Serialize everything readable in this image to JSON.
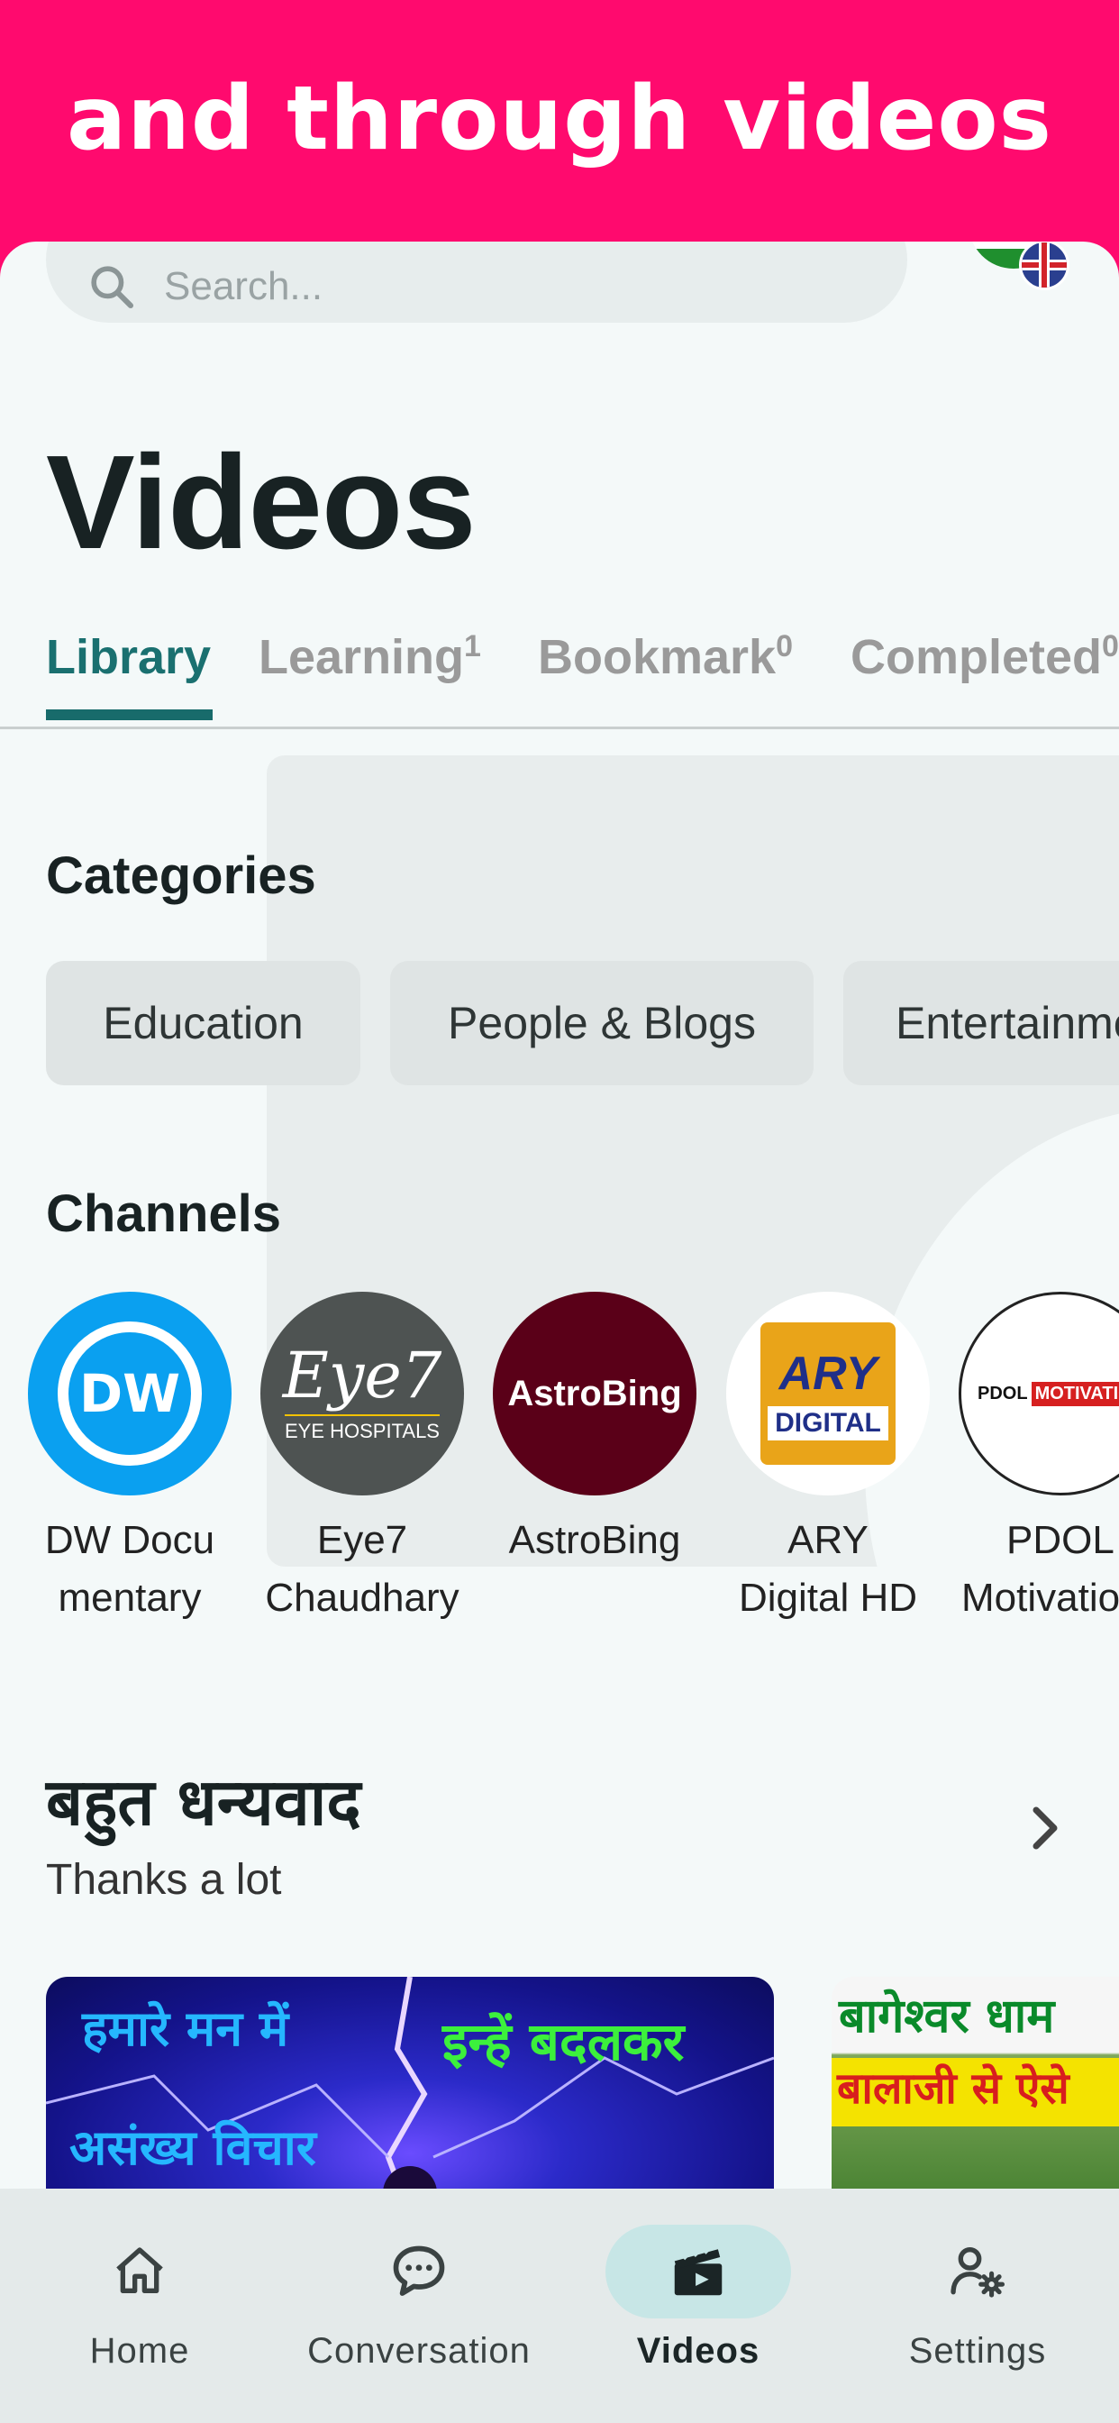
{
  "banner": {
    "text": "and through videos"
  },
  "search": {
    "placeholder": "Search..."
  },
  "page": {
    "title": "Videos"
  },
  "tabs": [
    {
      "label": "Library",
      "count": ""
    },
    {
      "label": "Learning",
      "count": "1"
    },
    {
      "label": "Bookmark",
      "count": "0"
    },
    {
      "label": "Completed",
      "count": "0"
    }
  ],
  "categories": {
    "title": "Categories",
    "items": [
      "Education",
      "People & Blogs",
      "Entertainment"
    ]
  },
  "channels": {
    "title": "Channels",
    "items": [
      {
        "name": "DW Documentary",
        "line1": "DW Docu",
        "line2": "mentary",
        "logo": "DW"
      },
      {
        "name": "Eye7 Chaudhary",
        "line1": "Eye7",
        "line2": "Chaudhary",
        "logo": "Eye7",
        "logo_sub": "EYE HOSPITALS"
      },
      {
        "name": "AstroBing",
        "line1": "AstroBing",
        "line2": "",
        "logo": "AstroBing"
      },
      {
        "name": "ARY Digital HD",
        "line1": "ARY",
        "line2": "Digital HD",
        "logo": "ARY",
        "logo_sub": "DIGITAL"
      },
      {
        "name": "PDOL Motivation",
        "line1": "PDOL",
        "line2": "Motivatio",
        "logo": "PDOL",
        "logo_sub": "MOTIVATION"
      }
    ]
  },
  "playlist": {
    "title": "बहुत धन्यवाद",
    "subtitle": "Thanks a lot",
    "videos": [
      {
        "caption_left": "हमारे मन में",
        "caption_right": "इन्हें बदलकर",
        "caption_bottom": "असंख्य विचार"
      },
      {
        "caption_top": "बागेश्वर धाम",
        "caption_mid": "बालाजी से ऐसे"
      }
    ]
  },
  "nav": [
    {
      "label": "Home",
      "icon": "home-icon"
    },
    {
      "label": "Conversation",
      "icon": "chat-icon"
    },
    {
      "label": "Videos",
      "icon": "clapperboard-icon"
    },
    {
      "label": "Settings",
      "icon": "user-settings-icon"
    }
  ],
  "colors": {
    "accent": "#186b6b",
    "banner": "#ff0a6e",
    "active_pill": "#c7e6e6"
  }
}
